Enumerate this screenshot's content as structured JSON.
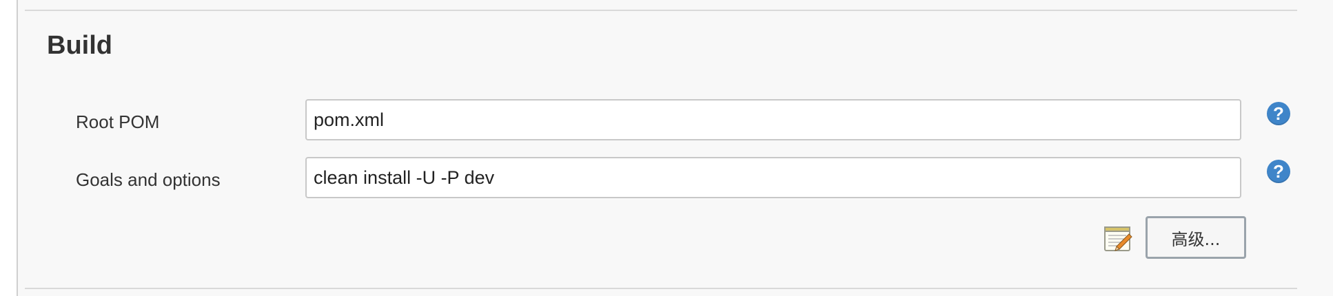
{
  "section": {
    "title": "Build"
  },
  "fields": {
    "root_pom": {
      "label": "Root POM",
      "value": "pom.xml"
    },
    "goals": {
      "label": "Goals and options",
      "value": "clean install -U -P dev"
    }
  },
  "help": {
    "glyph": "?"
  },
  "actions": {
    "advanced_label": "高级..."
  },
  "colors": {
    "help_icon": "#3f85c9",
    "panel_bg": "#f8f8f8"
  }
}
